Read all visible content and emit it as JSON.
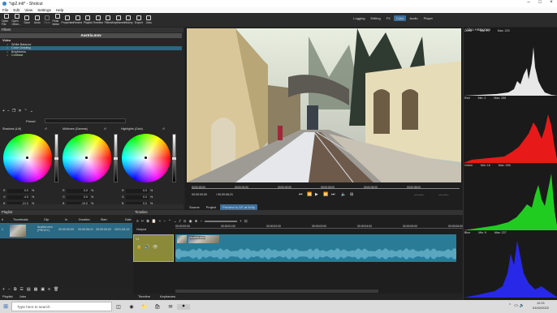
{
  "window": {
    "title": "*qp2.mlt* - Shotcut"
  },
  "menu": [
    "File",
    "Edit",
    "View",
    "Settings",
    "Help"
  ],
  "toolbar": [
    {
      "label": "Open File",
      "icon": "open-file-icon"
    },
    {
      "label": "Open Other...",
      "icon": "open-other-icon"
    },
    {
      "label": "Save",
      "icon": "save-icon"
    },
    {
      "label": "Undo",
      "icon": "undo-icon"
    },
    {
      "label": "Redo",
      "icon": "redo-icon"
    },
    {
      "label": "Peak Meter",
      "icon": "peak-meter-icon"
    },
    {
      "label": "Properties",
      "icon": "properties-icon"
    },
    {
      "label": "Recent",
      "icon": "recent-icon"
    },
    {
      "label": "Playlist",
      "icon": "playlist-icon"
    },
    {
      "label": "Timeline",
      "icon": "timeline-icon"
    },
    {
      "label": "Filters",
      "icon": "filters-icon"
    },
    {
      "label": "Keyframes",
      "icon": "keyframes-icon"
    },
    {
      "label": "History",
      "icon": "history-icon"
    },
    {
      "label": "Export",
      "icon": "export-icon"
    },
    {
      "label": "Jobs",
      "icon": "jobs-icon"
    }
  ],
  "layouts": {
    "items": [
      "Logging",
      "Editing",
      "FX",
      "Color",
      "Audio",
      "Player"
    ],
    "active": "Color"
  },
  "filters": {
    "header": "Filters",
    "clip": "Austria.mov",
    "category": "Video",
    "items": [
      "White Balance",
      "Color Grading",
      "Brightness",
      "Contrast"
    ],
    "selected": "Color Grading",
    "preset_label": "Preset",
    "wheels": [
      {
        "label": "Shadows (Lift)",
        "values": [
          "0.0",
          "-4.0",
          "-21.0"
        ]
      },
      {
        "label": "Midtones (Gamma)",
        "values": [
          "0.0",
          "0.0",
          "-10.0"
        ]
      },
      {
        "label": "Highlights (Gain)",
        "values": [
          "0.0",
          "0.0",
          "0.0"
        ]
      }
    ],
    "channels": [
      "R",
      "G",
      "B"
    ],
    "unit": "%"
  },
  "viewer": {
    "position": "00:00:00:00",
    "duration": "/ 00:00:06:21",
    "ticks": [
      "00:00:00:00",
      "00:00:01:00",
      "00:00:02:00",
      "00:00:03:00",
      "00:00:04:00",
      "00:00:05:00"
    ],
    "in_point": "--:--:--:--",
    "out_point": "--:--:--:--",
    "tabs": [
      "Source",
      "Project"
    ],
    "proxy_button": "Preview to OS at 540p"
  },
  "histogram": {
    "title": "Video Histogram",
    "channels": [
      {
        "name": "Luma",
        "min": "Min: 29",
        "max": "Max: 223",
        "color": "#ffffff"
      },
      {
        "name": "Red",
        "min": "Min: 2",
        "max": "Max: 255",
        "color": "#ff1a1a"
      },
      {
        "name": "Green",
        "min": "Min: 16",
        "max": "Max: 255",
        "color": "#22e022"
      },
      {
        "name": "Blue",
        "min": "Min: 9",
        "max": "Max: 227",
        "color": "#2a2aff"
      }
    ]
  },
  "playlist": {
    "header": "Playlist",
    "columns": [
      "#",
      "Thumbnails",
      "Clip",
      "In",
      "Duration",
      "Start",
      "Date"
    ],
    "rows": [
      {
        "n": "1",
        "clip": "Austria.mov (PROXY)",
        "in": "00:00:00:00",
        "duration": "00:00:06:21",
        "start": "00:00:00:00",
        "date": "2021-05-15"
      }
    ],
    "bottom_tabs": [
      "Playlist",
      "Jobs"
    ]
  },
  "timeline": {
    "header": "Timeline",
    "track_output": "Output",
    "track": "V1",
    "clip": "Austria.mov",
    "ruler": [
      "00:00:00:00",
      "00:00:01:00",
      "00:00:02:00",
      "00:00:03:00",
      "00:00:04:00",
      "00:00:05:00",
      "00:00:06:00"
    ],
    "bottom_tabs": [
      "Timeline",
      "Keyframes"
    ]
  },
  "taskbar": {
    "search": "Type here to search",
    "time": "12:21",
    "date": "01/02/2022"
  }
}
